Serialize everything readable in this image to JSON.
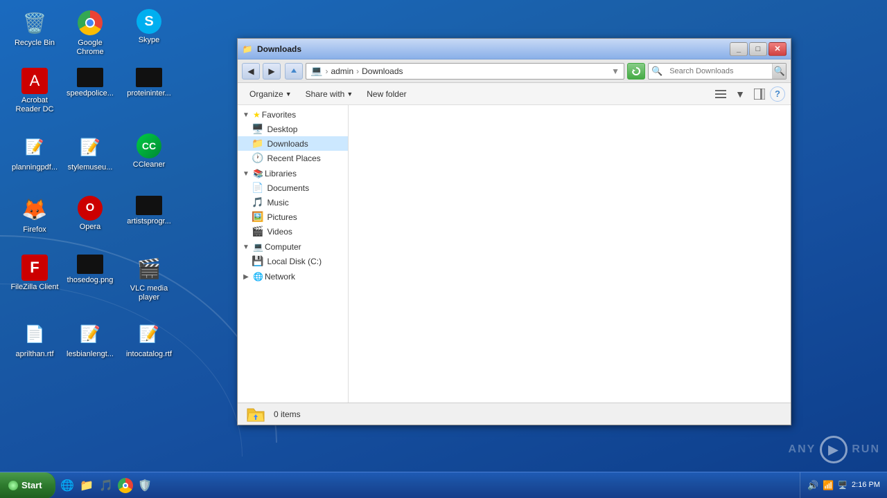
{
  "desktop": {
    "icons": [
      {
        "id": "recycle-bin",
        "label": "Recycle Bin",
        "icon": "🗑️",
        "row": 0,
        "col": 0
      },
      {
        "id": "acrobat",
        "label": "Acrobat Reader DC",
        "icon": "📕",
        "row": 1,
        "col": 0
      },
      {
        "id": "planning-pdf",
        "label": "planningpdf...",
        "icon": "📄",
        "row": 2,
        "col": 0
      },
      {
        "id": "firefox",
        "label": "Firefox",
        "icon": "🦊",
        "row": 3,
        "col": 0
      },
      {
        "id": "filezilla",
        "label": "FileZilla Client",
        "icon": "📁",
        "row": 4,
        "col": 0
      },
      {
        "id": "aprilthan",
        "label": "aprilthan.rtf",
        "icon": "📝",
        "row": 5,
        "col": 0
      },
      {
        "id": "chrome",
        "label": "Google Chrome",
        "icon": "chrome",
        "row": 0,
        "col": 1
      },
      {
        "id": "speedpolice",
        "label": "speedpolice...",
        "icon": "⬛",
        "row": 1,
        "col": 1
      },
      {
        "id": "stylemuseu",
        "label": "stylemuseu...",
        "icon": "📝",
        "row": 2,
        "col": 1
      },
      {
        "id": "opera",
        "label": "Opera",
        "icon": "🔴",
        "row": 3,
        "col": 1
      },
      {
        "id": "thosedog",
        "label": "thosedog.png",
        "icon": "⬛",
        "row": 4,
        "col": 1
      },
      {
        "id": "lesbianlengt",
        "label": "lesbianlengt...",
        "icon": "📝",
        "row": 5,
        "col": 1
      },
      {
        "id": "skype",
        "label": "Skype",
        "icon": "💬",
        "row": 0,
        "col": 2
      },
      {
        "id": "proteininter",
        "label": "proteininter...",
        "icon": "⬛",
        "row": 1,
        "col": 2
      },
      {
        "id": "ccleaner",
        "label": "CCleaner",
        "icon": "🔧",
        "row": 2,
        "col": 2
      },
      {
        "id": "artistsprogr",
        "label": "artistsprogr...",
        "icon": "⬛",
        "row": 3,
        "col": 2
      },
      {
        "id": "vlc",
        "label": "VLC media player",
        "icon": "🎬",
        "row": 4,
        "col": 2
      },
      {
        "id": "intocatalog",
        "label": "intocatalog.rtf",
        "icon": "📝",
        "row": 5,
        "col": 2
      }
    ]
  },
  "taskbar": {
    "start_label": "Start",
    "items": [],
    "tray_icons": [
      "🔊",
      "📶",
      "🖥️"
    ],
    "clock": "2:16 PM"
  },
  "explorer": {
    "title": "Downloads",
    "address": {
      "path_parts": [
        "admin",
        "Downloads"
      ],
      "search_placeholder": "Search Downloads"
    },
    "toolbar": {
      "organize_label": "Organize",
      "share_with_label": "Share with",
      "new_folder_label": "New folder"
    },
    "nav_tree": {
      "sections": [
        {
          "id": "favorites",
          "header": "Favorites",
          "icon": "⭐",
          "items": [
            {
              "id": "desktop",
              "label": "Desktop",
              "icon": "🖥️",
              "indent": 1
            },
            {
              "id": "downloads",
              "label": "Downloads",
              "icon": "📁",
              "indent": 1,
              "selected": true
            },
            {
              "id": "recent-places",
              "label": "Recent Places",
              "icon": "🕐",
              "indent": 1
            }
          ]
        },
        {
          "id": "libraries",
          "header": "Libraries",
          "icon": "📚",
          "items": [
            {
              "id": "documents",
              "label": "Documents",
              "icon": "📄",
              "indent": 1
            },
            {
              "id": "music",
              "label": "Music",
              "icon": "🎵",
              "indent": 1
            },
            {
              "id": "pictures",
              "label": "Pictures",
              "icon": "🖼️",
              "indent": 1
            },
            {
              "id": "videos",
              "label": "Videos",
              "icon": "🎬",
              "indent": 1
            }
          ]
        },
        {
          "id": "computer",
          "header": "Computer",
          "icon": "💻",
          "items": [
            {
              "id": "local-disk",
              "label": "Local Disk (C:)",
              "icon": "💾",
              "indent": 1
            }
          ]
        },
        {
          "id": "network",
          "header": "Network",
          "icon": "🌐",
          "items": []
        }
      ]
    },
    "file_area": {
      "items": [],
      "empty": true
    },
    "status_bar": {
      "item_count": "0 items"
    }
  }
}
